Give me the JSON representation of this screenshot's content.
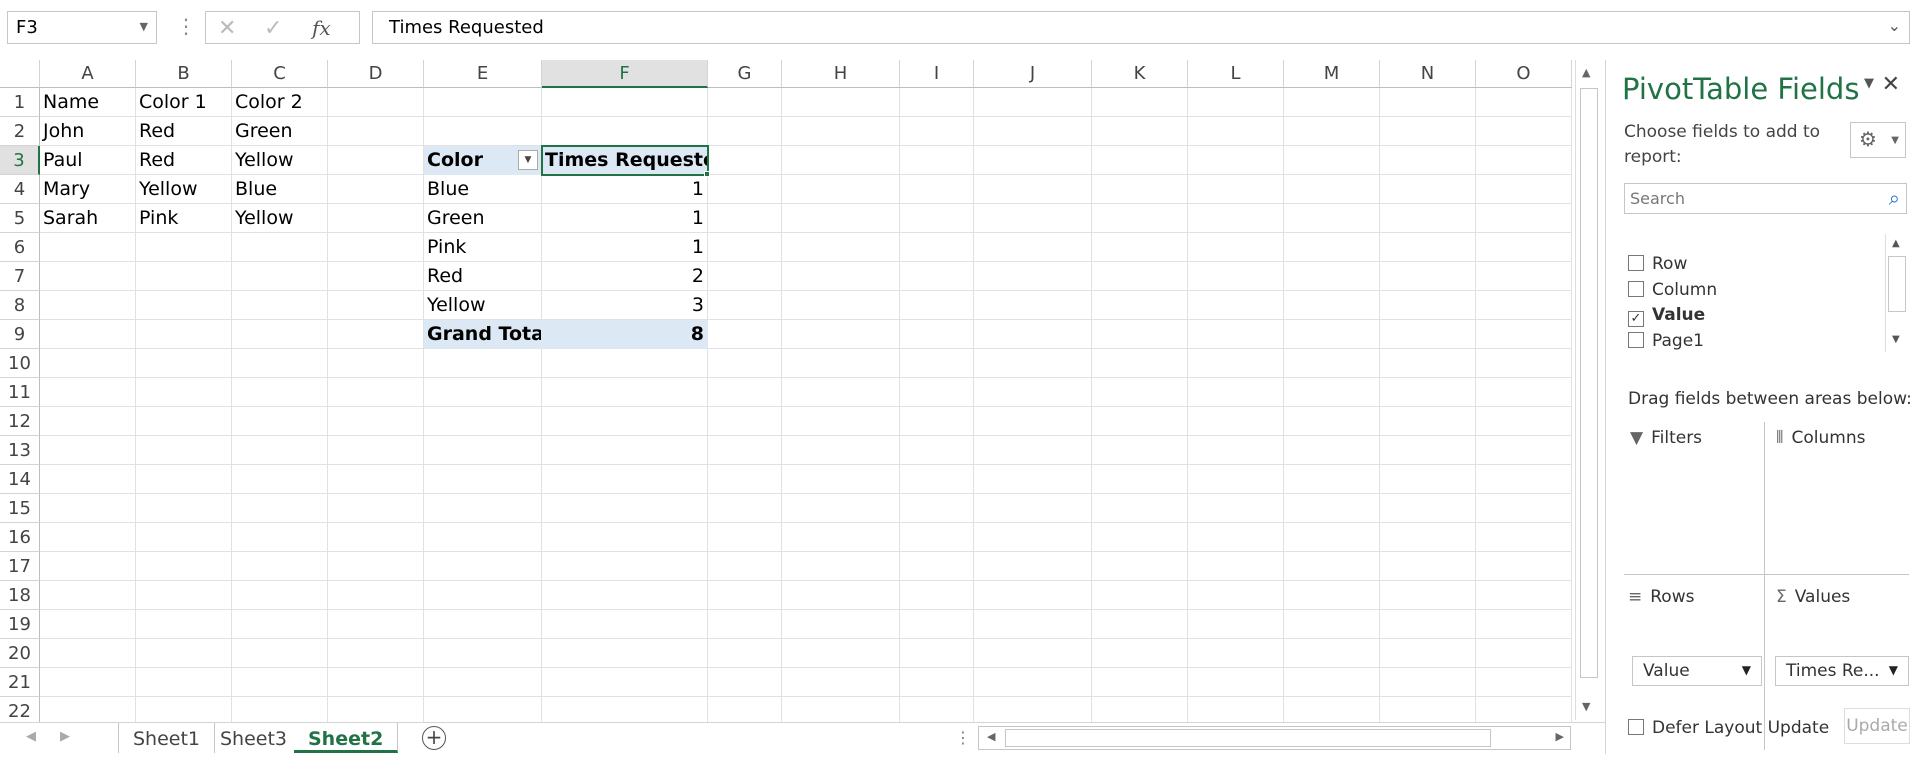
{
  "formula_bar": {
    "name_box": "F3",
    "cancel_icon": "✕",
    "enter_icon": "✓",
    "fx_label": "fx",
    "formula": "Times Requested"
  },
  "columns": [
    "A",
    "B",
    "C",
    "D",
    "E",
    "F",
    "G",
    "H",
    "I",
    "J",
    "K",
    "L",
    "M",
    "N",
    "O"
  ],
  "rows": [
    "1",
    "2",
    "3",
    "4",
    "5",
    "6",
    "7",
    "8",
    "9",
    "10",
    "11",
    "12",
    "13",
    "14",
    "15",
    "16",
    "17",
    "18",
    "19",
    "20",
    "21",
    "22"
  ],
  "selected": {
    "column": "F",
    "row": "3"
  },
  "source_table": {
    "headers": [
      "Name",
      "Color 1",
      "Color 2"
    ],
    "rows": [
      [
        "John",
        "Red",
        "Green"
      ],
      [
        "Paul",
        "Red",
        "Yellow"
      ],
      [
        "Mary",
        "Yellow",
        "Blue"
      ],
      [
        "Sarah",
        "Pink",
        "Yellow"
      ]
    ]
  },
  "pivot_table": {
    "row_header": "Color",
    "value_header": "Times Requested",
    "rows": [
      {
        "label": "Blue",
        "value": "1"
      },
      {
        "label": "Green",
        "value": "1"
      },
      {
        "label": "Pink",
        "value": "1"
      },
      {
        "label": "Red",
        "value": "2"
      },
      {
        "label": "Yellow",
        "value": "3"
      }
    ],
    "total_label": "Grand Total",
    "total_value": "8"
  },
  "sheet_tabs": {
    "tabs": [
      "Sheet1",
      "Sheet3",
      "Sheet2"
    ],
    "active": "Sheet2",
    "add_icon": "+"
  },
  "pivot_pane": {
    "title": "PivotTable Fields",
    "subtitle": "Choose fields to add to report:",
    "search_placeholder": "Search",
    "fields": [
      {
        "label": "Row",
        "checked": false
      },
      {
        "label": "Column",
        "checked": false
      },
      {
        "label": "Value",
        "checked": true
      },
      {
        "label": "Page1",
        "checked": false
      }
    ],
    "drag_text": "Drag fields between areas below:",
    "areas": {
      "filters": "Filters",
      "columns": "Columns",
      "rows": "Rows",
      "values": "Values"
    },
    "rows_pill": "Value",
    "values_pill": "Times Re...",
    "defer_label": "Defer Layout Update",
    "update_label": "Update"
  },
  "colors": {
    "accent": "#217346",
    "pivot_band": "#dce9f5"
  },
  "icons": {
    "close": "close-icon",
    "gear": "gear-icon",
    "search": "search-icon",
    "filter": "filter-icon"
  }
}
